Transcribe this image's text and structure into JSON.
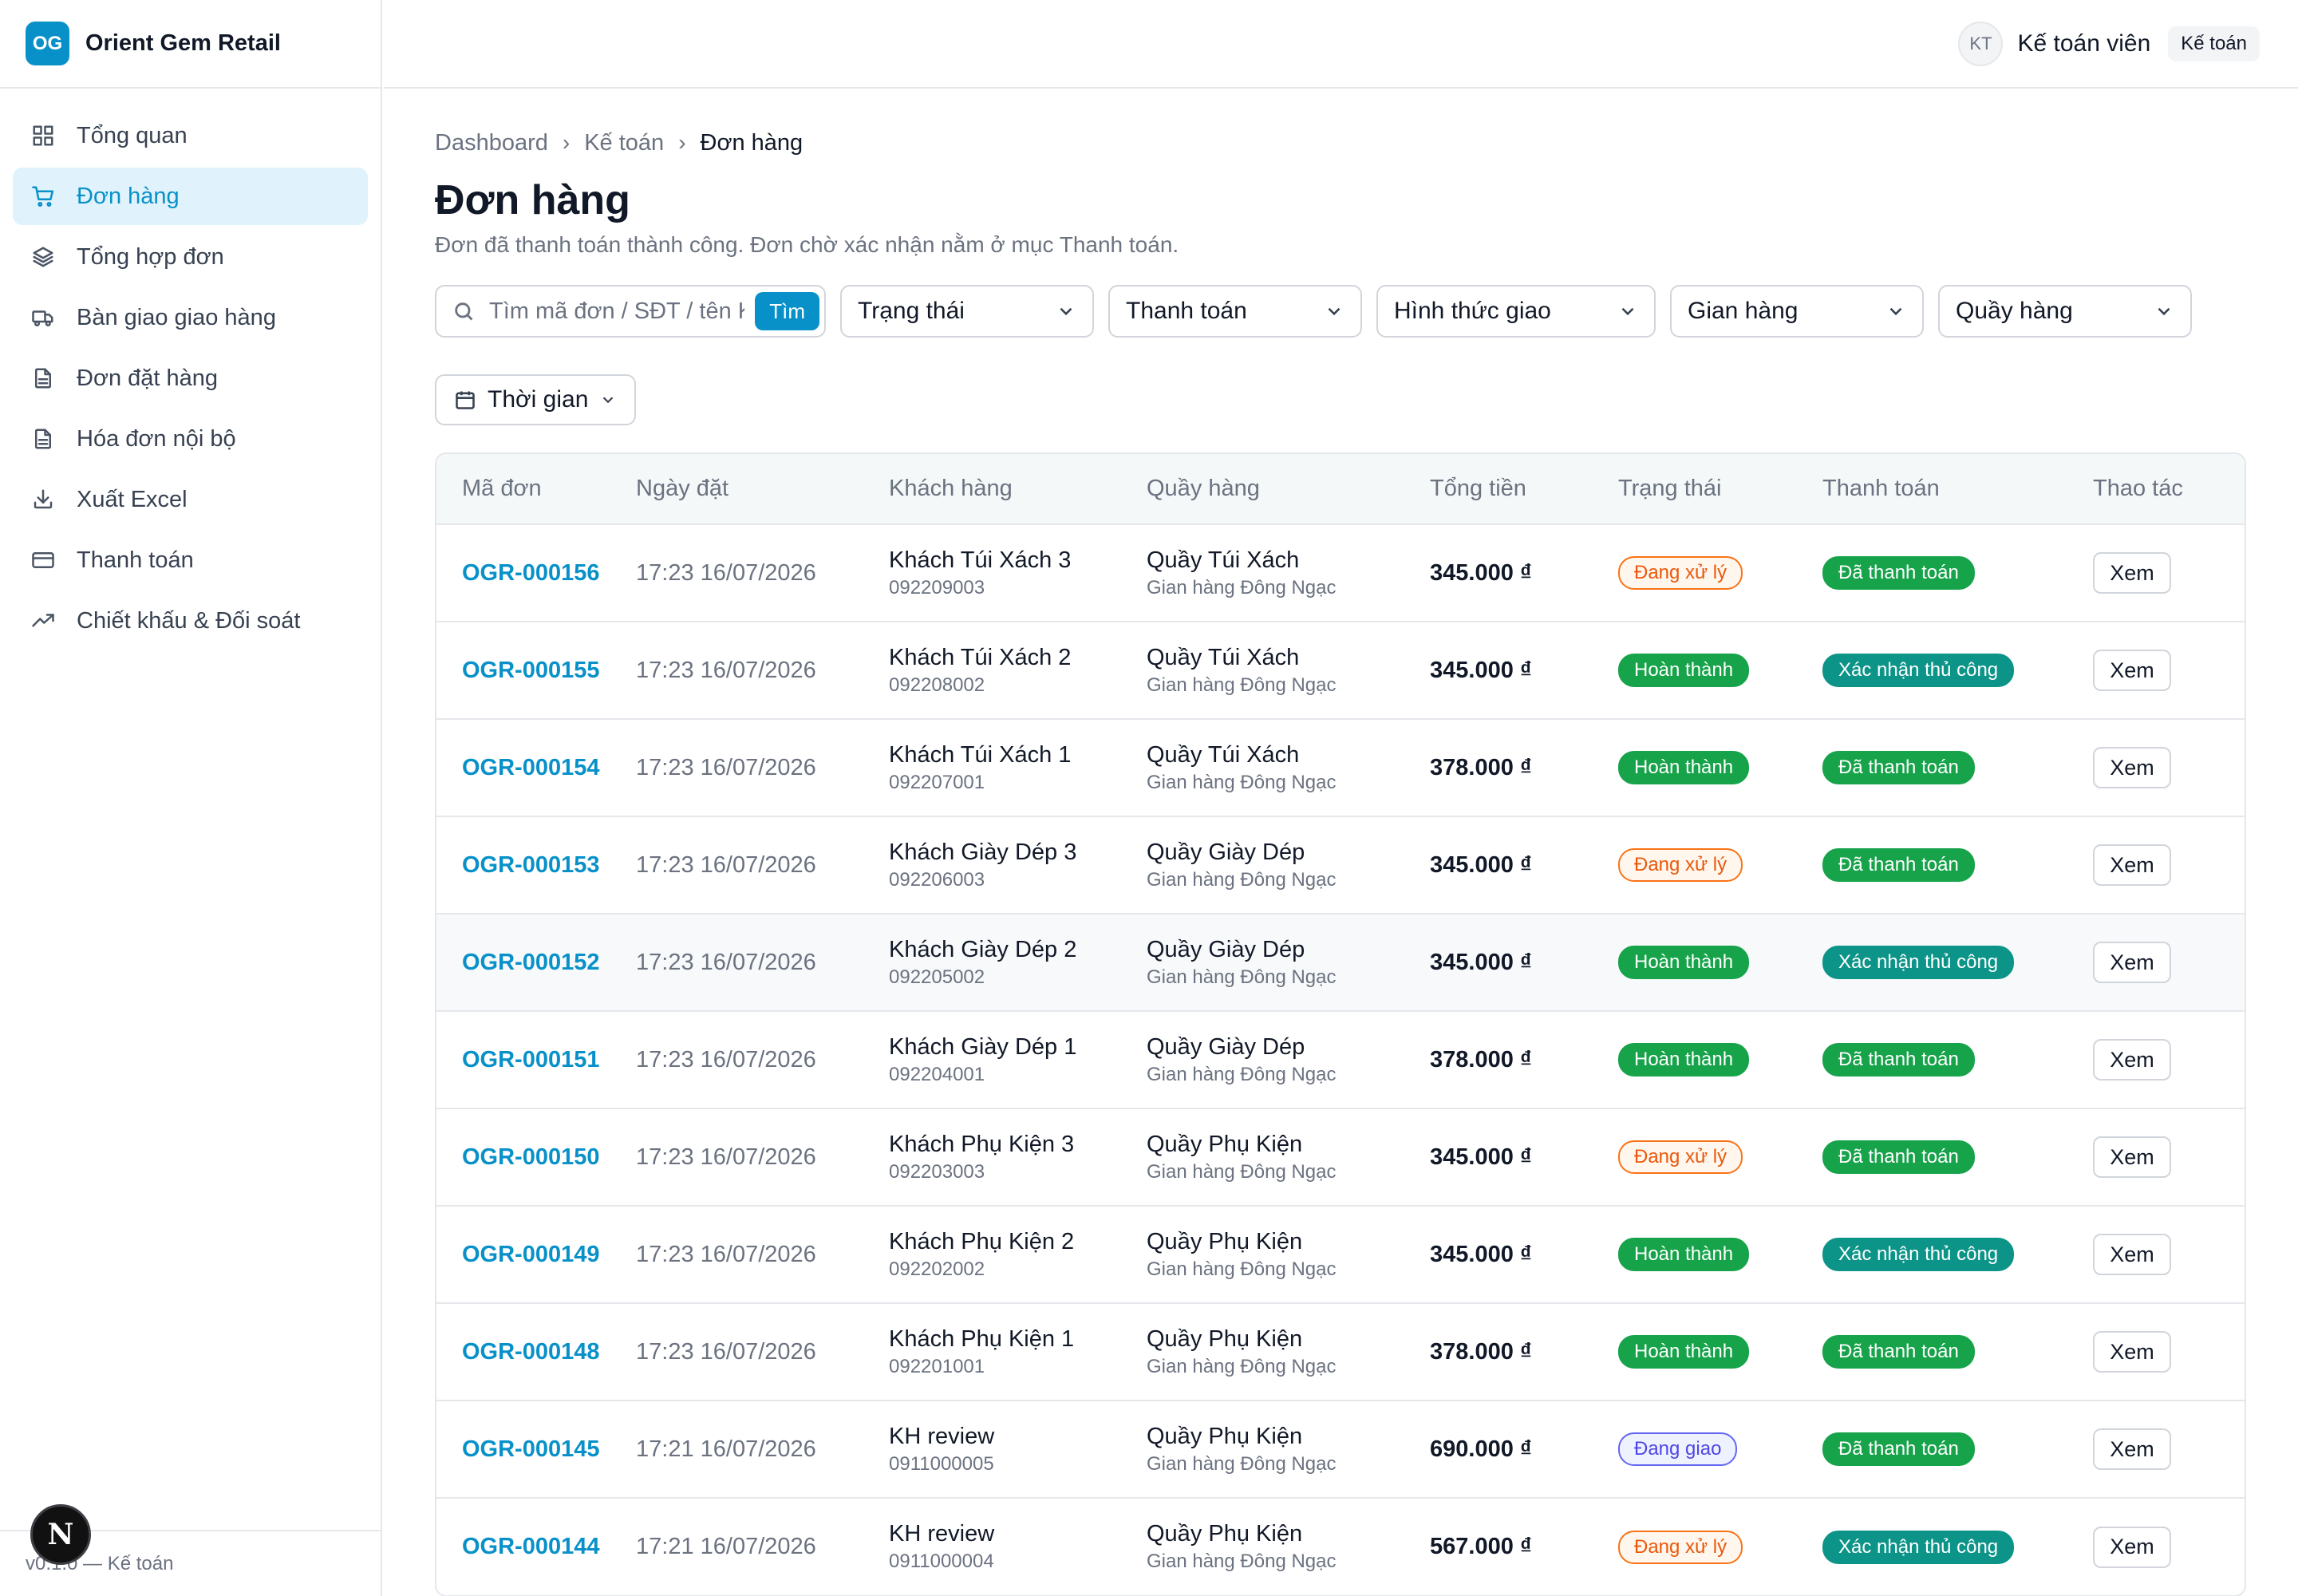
{
  "brand": {
    "logo": "OG",
    "name": "Orient Gem Retail"
  },
  "sidebar": {
    "items": [
      {
        "label": "Tổng quan",
        "icon": "grid-icon",
        "active": false
      },
      {
        "label": "Đơn hàng",
        "icon": "cart-icon",
        "active": true
      },
      {
        "label": "Tổng hợp đơn",
        "icon": "layers-icon",
        "active": false
      },
      {
        "label": "Bàn giao giao hàng",
        "icon": "truck-icon",
        "active": false
      },
      {
        "label": "Đơn đặt hàng",
        "icon": "file-icon",
        "active": false
      },
      {
        "label": "Hóa đơn nội bộ",
        "icon": "file-icon",
        "active": false
      },
      {
        "label": "Xuất Excel",
        "icon": "download-icon",
        "active": false
      },
      {
        "label": "Thanh toán",
        "icon": "card-icon",
        "active": false
      },
      {
        "label": "Chiết khấu & Đối soát",
        "icon": "trend-icon",
        "active": false
      }
    ],
    "footer": "v0.1.0 — Kế toán"
  },
  "header": {
    "avatar": "KT",
    "user_name": "Kế toán viên",
    "role": "Kế toán"
  },
  "breadcrumb": [
    "Dashboard",
    "Kế toán",
    "Đơn hàng"
  ],
  "page": {
    "title": "Đơn hàng",
    "subtitle": "Đơn đã thanh toán thành công. Đơn chờ xác nhận nằm ở mục Thanh toán."
  },
  "filters": {
    "search_placeholder": "Tìm mã đơn / SĐT / tên KH",
    "search_button": "Tìm",
    "status": "Trạng thái",
    "payment": "Thanh toán",
    "delivery": "Hình thức giao",
    "stall": "Gian hàng",
    "counter": "Quầy hàng",
    "time": "Thời gian"
  },
  "table": {
    "headers": [
      "Mã đơn",
      "Ngày đặt",
      "Khách hàng",
      "Quầy hàng",
      "Tổng tiền",
      "Trạng thái",
      "Thanh toán",
      "Thao tác"
    ],
    "rows": [
      {
        "code": "OGR-000156",
        "date": "17:23 16/07/2026",
        "customer": "Khách Túi Xách 3",
        "phone": "092209003",
        "counter": "Quầy Túi Xách",
        "stall": "Gian hàng Đông Ngạc",
        "total": "345.000 ₫",
        "status": "Đang xử lý",
        "status_type": "process",
        "payment": "Đã thanh toán",
        "payment_type": "paid",
        "action": "Xem"
      },
      {
        "code": "OGR-000155",
        "date": "17:23 16/07/2026",
        "customer": "Khách Túi Xách 2",
        "phone": "092208002",
        "counter": "Quầy Túi Xách",
        "stall": "Gian hàng Đông Ngạc",
        "total": "345.000 ₫",
        "status": "Hoàn thành",
        "status_type": "done",
        "payment": "Xác nhận thủ công",
        "payment_type": "manual",
        "action": "Xem"
      },
      {
        "code": "OGR-000154",
        "date": "17:23 16/07/2026",
        "customer": "Khách Túi Xách 1",
        "phone": "092207001",
        "counter": "Quầy Túi Xách",
        "stall": "Gian hàng Đông Ngạc",
        "total": "378.000 ₫",
        "status": "Hoàn thành",
        "status_type": "done",
        "payment": "Đã thanh toán",
        "payment_type": "paid",
        "action": "Xem"
      },
      {
        "code": "OGR-000153",
        "date": "17:23 16/07/2026",
        "customer": "Khách Giày Dép 3",
        "phone": "092206003",
        "counter": "Quầy Giày Dép",
        "stall": "Gian hàng Đông Ngạc",
        "total": "345.000 ₫",
        "status": "Đang xử lý",
        "status_type": "process",
        "payment": "Đã thanh toán",
        "payment_type": "paid",
        "action": "Xem"
      },
      {
        "code": "OGR-000152",
        "date": "17:23 16/07/2026",
        "customer": "Khách Giày Dép 2",
        "phone": "092205002",
        "counter": "Quầy Giày Dép",
        "stall": "Gian hàng Đông Ngạc",
        "total": "345.000 ₫",
        "status": "Hoàn thành",
        "status_type": "done",
        "payment": "Xác nhận thủ công",
        "payment_type": "manual",
        "action": "Xem",
        "highlight": true
      },
      {
        "code": "OGR-000151",
        "date": "17:23 16/07/2026",
        "customer": "Khách Giày Dép 1",
        "phone": "092204001",
        "counter": "Quầy Giày Dép",
        "stall": "Gian hàng Đông Ngạc",
        "total": "378.000 ₫",
        "status": "Hoàn thành",
        "status_type": "done",
        "payment": "Đã thanh toán",
        "payment_type": "paid",
        "action": "Xem"
      },
      {
        "code": "OGR-000150",
        "date": "17:23 16/07/2026",
        "customer": "Khách Phụ Kiện 3",
        "phone": "092203003",
        "counter": "Quầy Phụ Kiện",
        "stall": "Gian hàng Đông Ngạc",
        "total": "345.000 ₫",
        "status": "Đang xử lý",
        "status_type": "process",
        "payment": "Đã thanh toán",
        "payment_type": "paid",
        "action": "Xem"
      },
      {
        "code": "OGR-000149",
        "date": "17:23 16/07/2026",
        "customer": "Khách Phụ Kiện 2",
        "phone": "092202002",
        "counter": "Quầy Phụ Kiện",
        "stall": "Gian hàng Đông Ngạc",
        "total": "345.000 ₫",
        "status": "Hoàn thành",
        "status_type": "done",
        "payment": "Xác nhận thủ công",
        "payment_type": "manual",
        "action": "Xem"
      },
      {
        "code": "OGR-000148",
        "date": "17:23 16/07/2026",
        "customer": "Khách Phụ Kiện 1",
        "phone": "092201001",
        "counter": "Quầy Phụ Kiện",
        "stall": "Gian hàng Đông Ngạc",
        "total": "378.000 ₫",
        "status": "Hoàn thành",
        "status_type": "done",
        "payment": "Đã thanh toán",
        "payment_type": "paid",
        "action": "Xem"
      },
      {
        "code": "OGR-000145",
        "date": "17:21 16/07/2026",
        "customer": "KH review",
        "phone": "0911000005",
        "counter": "Quầy Phụ Kiện",
        "stall": "Gian hàng Đông Ngạc",
        "total": "690.000 ₫",
        "status": "Đang giao",
        "status_type": "ship",
        "payment": "Đã thanh toán",
        "payment_type": "paid",
        "action": "Xem"
      },
      {
        "code": "OGR-000144",
        "date": "17:21 16/07/2026",
        "customer": "KH review",
        "phone": "0911000004",
        "counter": "Quầy Phụ Kiện",
        "stall": "Gian hàng Đông Ngạc",
        "total": "567.000 ₫",
        "status": "Đang xử lý",
        "status_type": "process",
        "payment": "Xác nhận thủ công",
        "payment_type": "manual",
        "action": "Xem"
      }
    ]
  },
  "colors": {
    "accent": "#0891c9",
    "success": "#16a34a",
    "teal": "#0d9488",
    "warning": "#ea580c",
    "indigo": "#4f46e5"
  },
  "dev_badge": "N"
}
